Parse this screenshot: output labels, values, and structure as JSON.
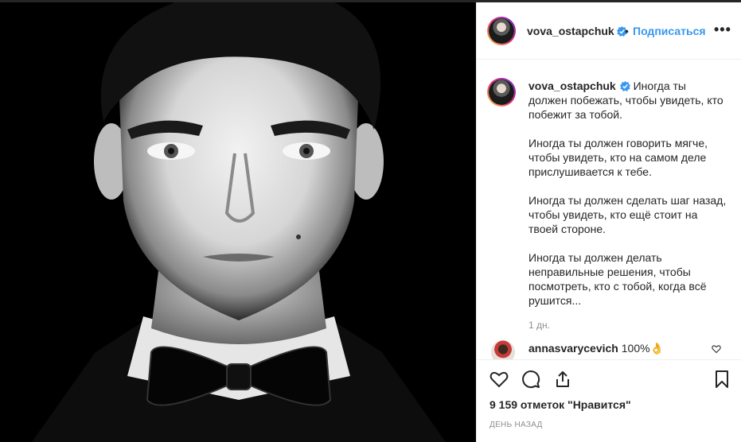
{
  "post": {
    "author": "vova_ostapchuk",
    "follow_separator": "•",
    "follow_label": "Подписаться",
    "more_label": "•••",
    "caption_author": "vova_ostapchuk",
    "caption_paragraphs": [
      "Иногда ты должен побежать, чтобы увидеть, кто побежит за тобой.",
      "Иногда ты должен говорить мягче, чтобы увидеть, кто на самом деле прислушивается к тебе.",
      "Иногда ты должен сделать шаг назад, чтобы увидеть, кто ещё стоит на твоей стороне.",
      "Иногда ты должен делать неправильные решения, чтобы посмотреть, кто с тобой, когда всё рушится..."
    ],
    "caption_time": "1 дн.",
    "comments": [
      {
        "author": "annasvarycevich",
        "text": "100%👌"
      }
    ],
    "likes_label": "9 159 отметок \"Нравится\"",
    "time_ago": "день назад"
  },
  "icons": {
    "verified": "verified-badge-icon",
    "heart": "heart-icon",
    "comment": "comment-icon",
    "share": "share-icon",
    "save": "bookmark-icon",
    "small_heart": "like-comment-icon"
  },
  "colors": {
    "accent": "#3897f0",
    "text": "#262626",
    "muted": "#8e8e8e",
    "border": "#efefef"
  }
}
